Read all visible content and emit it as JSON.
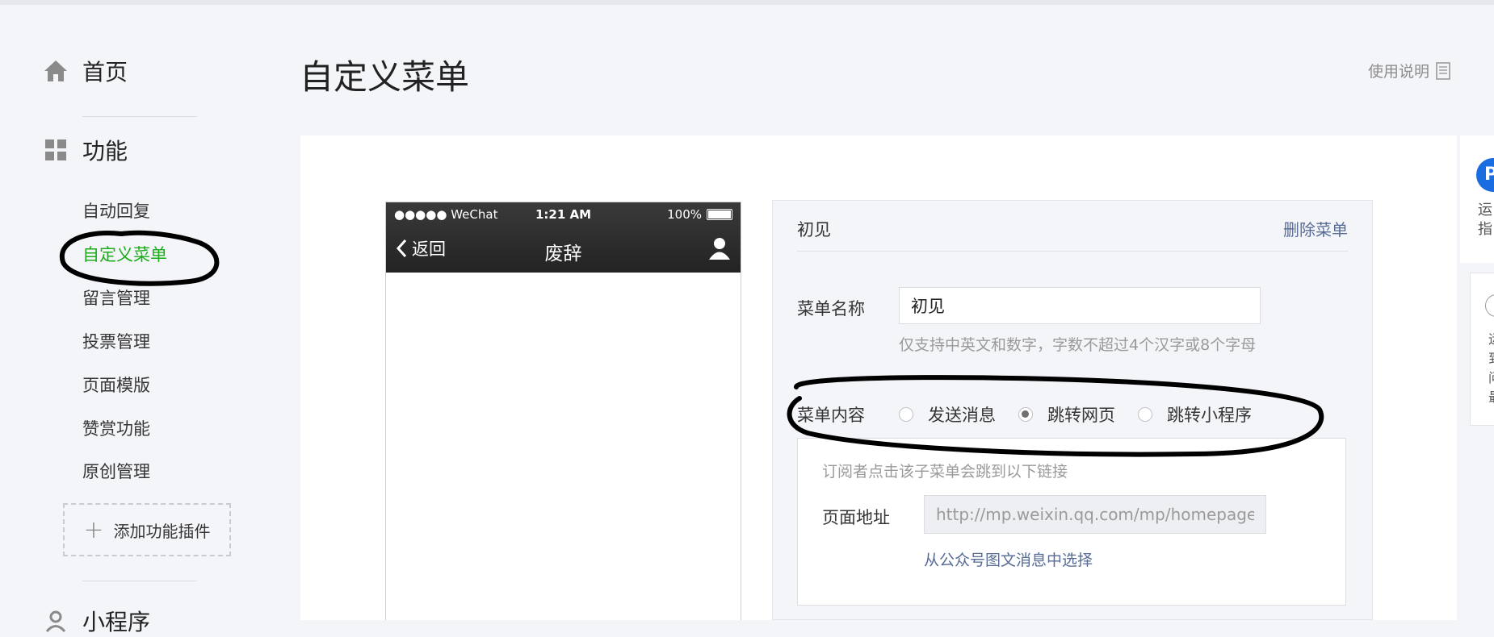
{
  "sidebar": {
    "home_label": "首页",
    "functions_label": "功能",
    "items": [
      {
        "label": "自动回复",
        "active": false
      },
      {
        "label": "自定义菜单",
        "active": true
      },
      {
        "label": "留言管理",
        "active": false
      },
      {
        "label": "投票管理",
        "active": false
      },
      {
        "label": "页面模版",
        "active": false
      },
      {
        "label": "赞赏功能",
        "active": false
      },
      {
        "label": "原创管理",
        "active": false
      }
    ],
    "add_plugin_label": "添加功能插件",
    "mini_program_label": "小程序"
  },
  "header": {
    "title": "自定义菜单",
    "help_label": "使用说明"
  },
  "phone": {
    "carrier": "●●●●● WeChat",
    "time": "1:21 AM",
    "battery": "100%",
    "back_label": "返回",
    "title": "废辞"
  },
  "editor": {
    "menu_name_header": "初见",
    "delete_label": "删除菜单",
    "name_label": "菜单名称",
    "name_value": "初见",
    "name_hint": "仅支持中英文和数字，字数不超过4个汉字或8个字母",
    "content_label": "菜单内容",
    "content_options": [
      {
        "label": "发送消息",
        "selected": false
      },
      {
        "label": "跳转网页",
        "selected": true
      },
      {
        "label": "跳转小程序",
        "selected": false
      }
    ],
    "link_hint": "订阅者点击该子菜单会跳到以下链接",
    "url_label": "页面地址",
    "url_value": "http://mp.weixin.qq.com/mp/homepage",
    "choose_link": "从公众号图文消息中选择"
  },
  "side_widgets": {
    "badge_letter": "P",
    "text1_line1": "运",
    "text1_line2": "指",
    "text2_lines": [
      "运",
      "到",
      "问",
      "最"
    ]
  },
  "colors": {
    "accent_green": "#1aad19",
    "link_blue": "#576b95",
    "background": "#f4f5f9"
  }
}
